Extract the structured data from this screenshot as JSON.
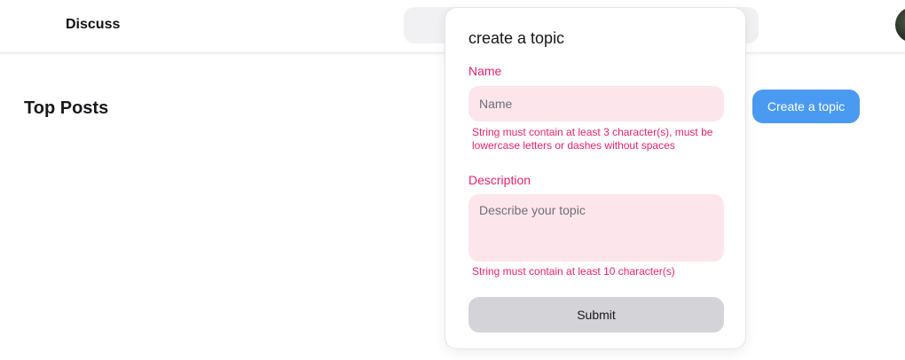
{
  "header": {
    "brand": "Discuss",
    "search": {
      "value": "",
      "placeholder": ""
    }
  },
  "main": {
    "title": "Top Posts",
    "create_topic_button": "Create a topic"
  },
  "popover": {
    "title": "create a topic",
    "name": {
      "label": "Name",
      "placeholder": "Name",
      "value": "",
      "error": "String must contain at least 3 character(s), must be lowercase letters or dashes without spaces"
    },
    "description": {
      "label": "Description",
      "placeholder": "Describe your topic",
      "value": "",
      "error": "String must contain at least 10 character(s)"
    },
    "submit_label": "Submit"
  },
  "colors": {
    "accent": "#4a9af1",
    "error": "#e5226c",
    "input_error_bg": "#fde5ec",
    "submit_bg": "#d4d4d8"
  }
}
